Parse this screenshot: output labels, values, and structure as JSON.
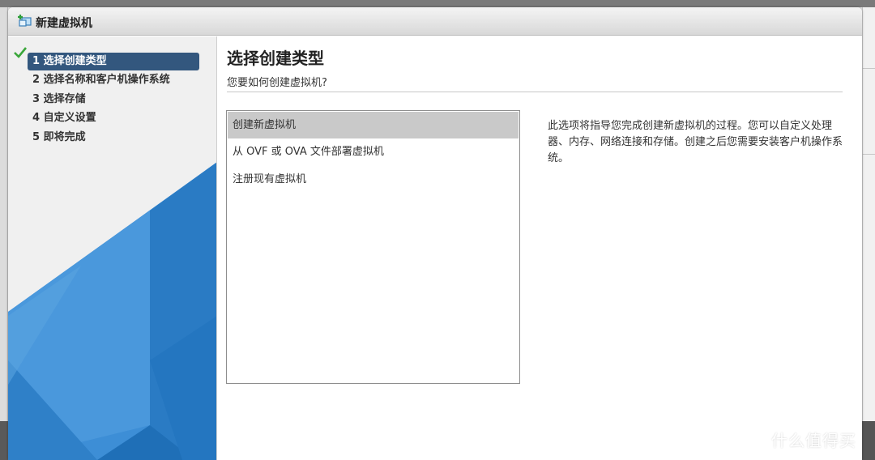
{
  "dialog": {
    "title": "新建虚拟机",
    "title_icon": "new-vm-icon"
  },
  "sidebar": {
    "steps": [
      {
        "label": "1 选择创建类型",
        "active": true,
        "completed_icon": "check-icon"
      },
      {
        "label": "2 选择名称和客户机操作系统",
        "active": false
      },
      {
        "label": "3 选择存储",
        "active": false
      },
      {
        "label": "4 自定义设置",
        "active": false
      },
      {
        "label": "5 即将完成",
        "active": false
      }
    ]
  },
  "main": {
    "title": "选择创建类型",
    "subtitle": "您要如何创建虚拟机?",
    "options": [
      {
        "label": "创建新虚拟机",
        "selected": true
      },
      {
        "label": "从 OVF 或 OVA 文件部署虚拟机",
        "selected": false
      },
      {
        "label": "注册现有虚拟机",
        "selected": false
      }
    ],
    "description": "此选项将指导您完成创建新虚拟机的过程。您可以自定义处理器、内存、网络连接和存储。创建之后您需要安装客户机操作系统。"
  },
  "watermark": {
    "text": "什么值得买"
  },
  "colors": {
    "active_step_bg": "#33577e",
    "selected_option_bg": "#c9c9c9",
    "check_green": "#3aa63a",
    "deco_blue": "#2a7bc4"
  }
}
